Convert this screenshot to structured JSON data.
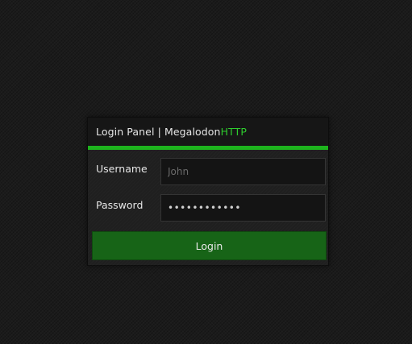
{
  "panel": {
    "title_prefix": "Login Panel | Megalodon",
    "title_accent": "HTTP"
  },
  "form": {
    "username_label": "Username",
    "username_placeholder": "John",
    "username_value": "",
    "password_label": "Password",
    "password_value": "............",
    "login_label": "Login"
  },
  "colors": {
    "accent": "#1db31d",
    "button": "#176417",
    "background": "#1b1b1b"
  }
}
